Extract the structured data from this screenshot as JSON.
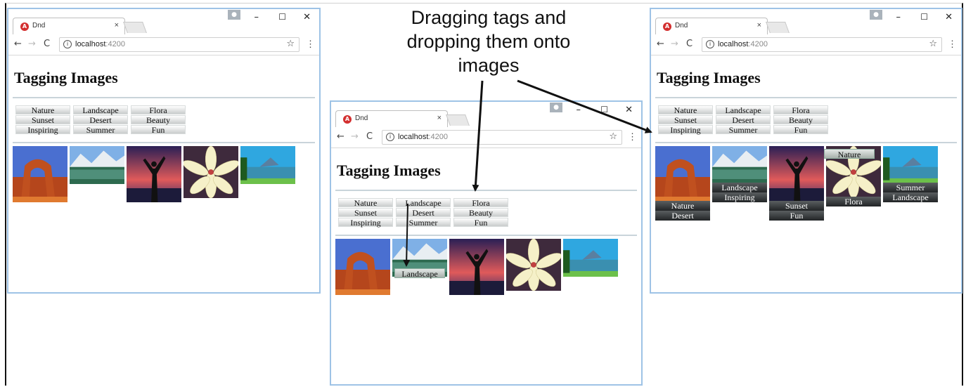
{
  "caption": {
    "line1": "Dragging tags and",
    "line2": "dropping them onto",
    "line3": "images"
  },
  "browser": {
    "tab_title": "Dnd",
    "tab_close": "×",
    "url_host": "localhost",
    "url_port": ":4200",
    "back": "←",
    "forward": "→",
    "reload": "C",
    "info": "i",
    "star": "☆",
    "menu": "⋮",
    "minimize": "–",
    "maximize": "☐",
    "close": "✕"
  },
  "app": {
    "title": "Tagging Images",
    "tags": [
      {
        "label": "Nature"
      },
      {
        "label": "Landscape"
      },
      {
        "label": "Flora"
      },
      {
        "label": "Sunset"
      },
      {
        "label": "Desert"
      },
      {
        "label": "Beauty"
      },
      {
        "label": "Inspiring"
      },
      {
        "label": "Summer"
      },
      {
        "label": "Fun"
      }
    ],
    "images": [
      {
        "subject": "arch"
      },
      {
        "subject": "mountain-lake"
      },
      {
        "subject": "person-sunset"
      },
      {
        "subject": "lily-flower"
      },
      {
        "subject": "lakeside"
      }
    ]
  },
  "windows": {
    "before": {
      "image_tags": [
        [],
        [],
        [],
        [],
        []
      ]
    },
    "dragging": {
      "dragged_tag": "Landscape",
      "image_tags": [
        [],
        [],
        [],
        [],
        []
      ]
    },
    "after": {
      "dragged_tag": "Nature",
      "image_tags": [
        [
          "Nature",
          "Desert"
        ],
        [
          "Landscape",
          "Inspiring"
        ],
        [
          "Sunset",
          "Fun"
        ],
        [
          "Flora"
        ],
        [
          "Summer",
          "Landscape"
        ]
      ]
    }
  },
  "colors": {
    "window_border": "#9ec3e6",
    "tag_gradient_top": "#ffffff",
    "tag_gradient_bottom": "#c9cccc",
    "image_label_bg": "#222527"
  }
}
